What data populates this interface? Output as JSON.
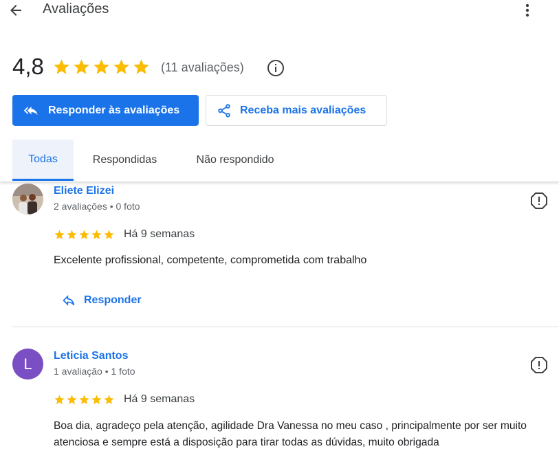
{
  "header": {
    "title": "Avaliações",
    "back_icon": "arrow-left-icon",
    "menu_icon": "more-vert-icon"
  },
  "summary": {
    "rating": "4,8",
    "stars": 5,
    "count_text": "(11 avaliações)",
    "info_icon": "info-icon"
  },
  "actions": {
    "respond_label": "Responder às avaliações",
    "get_more_label": "Receba mais avaliações"
  },
  "tabs": [
    {
      "label": "Todas",
      "active": true
    },
    {
      "label": "Respondidas",
      "active": false
    },
    {
      "label": "Não respondido",
      "active": false
    }
  ],
  "reviews": [
    {
      "name": "Eliete Elizei",
      "meta": "2 avaliações • 0 foto",
      "stars": 5,
      "date": "Há 9 semanas",
      "text": "Excelente profissional, competente, comprometida com trabalho",
      "reply_label": "Responder"
    },
    {
      "name": "Leticia Santos",
      "avatar_letter": "L",
      "meta": "1 avaliação • 1 foto",
      "stars": 5,
      "date": "Há 9 semanas",
      "text": "Boa dia, agradeço pela atenção, agilidade Dra Vanessa no meu caso , principalmente por ser muito atenciosa e sempre está a disposição para tirar todas as dúvidas, muito obrigada"
    }
  ],
  "colors": {
    "accent": "#1a73e8",
    "star": "#fbbc04",
    "avatar_purple": "#7b4fc4"
  }
}
